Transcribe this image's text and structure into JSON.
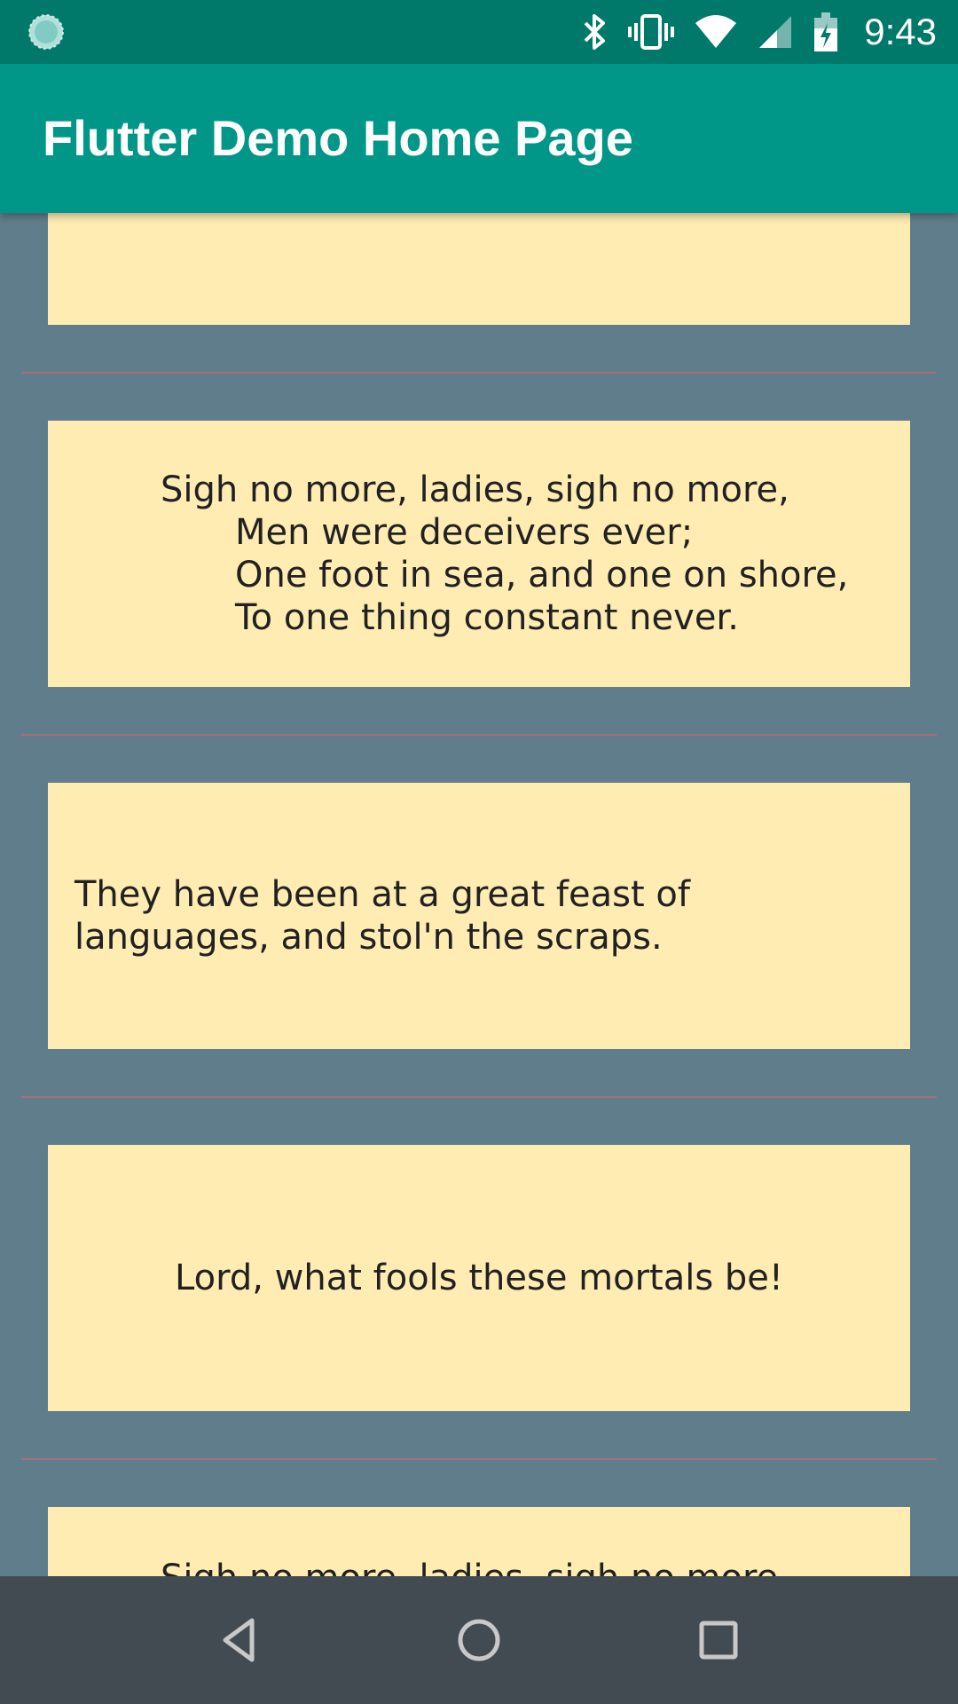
{
  "status_bar": {
    "time": "9:43",
    "icons": [
      "loading-spinner-icon",
      "bluetooth-icon",
      "vibrate-icon",
      "wifi-icon",
      "cell-signal-icon",
      "battery-charging-icon"
    ],
    "background_color": "#00796b"
  },
  "app_bar": {
    "title": "Flutter Demo Home Page",
    "background_color": "#009688"
  },
  "list": {
    "background_color": "#607d8b",
    "card_color": "#ffecb3",
    "items": [
      {
        "type": "blank"
      },
      {
        "type": "poem",
        "lines": [
          "Sigh no more, ladies, sigh no more,",
          "Men were deceivers ever;",
          "One foot in sea, and one on shore,",
          "To one thing constant never."
        ]
      },
      {
        "type": "prose",
        "text": "They have been at a great feast of languages, and stol'n the scraps."
      },
      {
        "type": "centered",
        "text": "Lord, what fools these mortals be!"
      },
      {
        "type": "poem",
        "lines": [
          "Sigh no more, ladies, sigh no more,"
        ]
      }
    ]
  },
  "nav_bar": {
    "buttons": [
      "back-icon",
      "home-icon",
      "recents-icon"
    ],
    "background_color": "#424a52"
  }
}
